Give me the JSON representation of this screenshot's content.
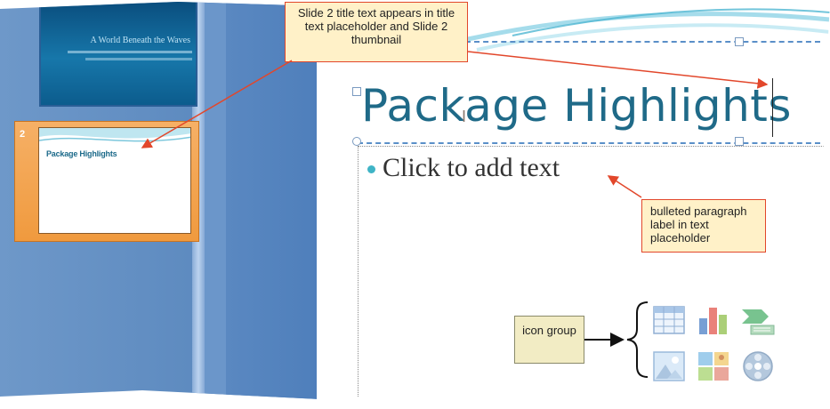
{
  "slides_pane": {
    "slide1": {
      "title": "A World Beneath the Waves"
    },
    "slide2": {
      "number": "2",
      "title": "Package Highlights"
    }
  },
  "slide": {
    "title": "Package Highlights",
    "body_placeholder": "Click to add text",
    "content_icons": [
      "table-icon",
      "chart-icon",
      "smartart-icon",
      "picture-icon",
      "clip-art-icon",
      "media-icon"
    ]
  },
  "callouts": {
    "title_callout": "Slide 2 title text appears in title text placeholder and Slide 2 thumbnail",
    "bullet_callout": "bulleted paragraph label in text placeholder",
    "icon_callout": "icon group"
  },
  "colors": {
    "title_teal": "#1f6a88",
    "bullet_teal": "#3fb4c6",
    "callout_border": "#e2472b",
    "callout_fill": "#fff1c8",
    "pane_blue": "#5e8bc0",
    "selected_thumb_orange": "#f09a3e"
  }
}
